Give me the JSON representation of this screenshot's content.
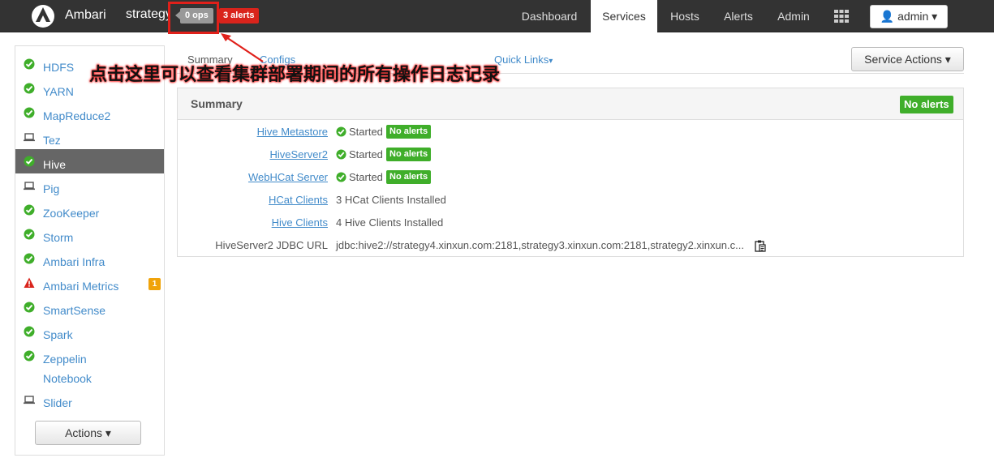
{
  "topbar": {
    "brand": "Ambari",
    "cluster": "strategy",
    "ops": "0 ops",
    "alerts": "3 alerts",
    "nav": [
      "Dashboard",
      "Services",
      "Hosts",
      "Alerts",
      "Admin"
    ],
    "user": "admin"
  },
  "sidebar": {
    "items": [
      {
        "label": "HDFS",
        "status": "ok"
      },
      {
        "label": "YARN",
        "status": "ok"
      },
      {
        "label": "MapReduce2",
        "status": "ok"
      },
      {
        "label": "Tez",
        "status": "client"
      },
      {
        "label": "Hive",
        "status": "ok"
      },
      {
        "label": "Pig",
        "status": "client"
      },
      {
        "label": "ZooKeeper",
        "status": "ok"
      },
      {
        "label": "Storm",
        "status": "ok"
      },
      {
        "label": "Ambari Infra",
        "status": "ok"
      },
      {
        "label": "Ambari Metrics",
        "status": "alert",
        "count": "1"
      },
      {
        "label": "SmartSense",
        "status": "ok"
      },
      {
        "label": "Spark",
        "status": "ok"
      },
      {
        "label": "Zeppelin",
        "status": "ok"
      },
      {
        "label": "Notebook",
        "status": ""
      },
      {
        "label": "Slider",
        "status": "client"
      }
    ],
    "actions": "Actions"
  },
  "tabs": {
    "summary": "Summary",
    "configs": "Configs",
    "quick_links": "Quick Links"
  },
  "service_actions": "Service Actions",
  "panel": {
    "title": "Summary",
    "no_alerts": "No alerts",
    "rows": [
      {
        "key": "Hive Metastore",
        "value": "Started",
        "badge": "No alerts"
      },
      {
        "key": "HiveServer2",
        "value": "Started",
        "badge": "No alerts"
      },
      {
        "key": "WebHCat Server",
        "value": "Started",
        "badge": "No alerts"
      },
      {
        "key": "HCat Clients",
        "value": "3 HCat Clients Installed"
      },
      {
        "key": "Hive Clients",
        "value": "4 Hive Clients Installed"
      },
      {
        "key": "HiveServer2 JDBC URL",
        "value": "jdbc:hive2://strategy4.xinxun.com:2181,strategy3.xinxun.com:2181,strategy2.xinxun.c..."
      }
    ]
  },
  "annotation": "点击这里可以查看集群部署期间的所有操作日志记录",
  "colors": {
    "topbar": "#333333",
    "ok": "#3fae2a",
    "alert": "#d9241c",
    "link": "#428bca",
    "highlight": "#e0201a"
  }
}
